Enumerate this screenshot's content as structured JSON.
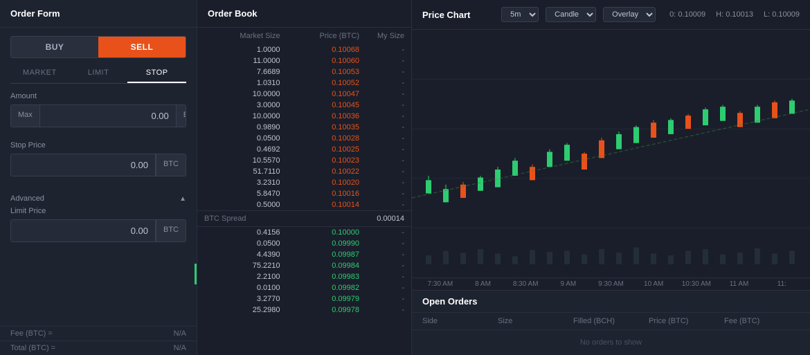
{
  "orderForm": {
    "title": "Order Form",
    "buyLabel": "BUY",
    "sellLabel": "SELL",
    "orderTypes": [
      "MARKET",
      "LIMIT",
      "STOP"
    ],
    "activeOrderType": "STOP",
    "amountLabel": "Amount",
    "amountPrefix": "Max",
    "amountValue": "0.00",
    "amountCurrency": "BCH",
    "stopPriceLabel": "Stop Price",
    "stopPriceValue": "0.00",
    "stopPriceCurrency": "BTC",
    "advancedLabel": "Advanced",
    "limitPriceLabel": "Limit Price",
    "limitPriceValue": "0.00",
    "limitPriceCurrency": "BTC",
    "feeLabelLeft": "Fee (BTC) =",
    "feeValueRight": "N/A",
    "totalLabelLeft": "Total (BTC) =",
    "totalValueRight": "N/A"
  },
  "orderBook": {
    "title": "Order Book",
    "headers": {
      "marketSize": "Market Size",
      "price": "Price (BTC)",
      "mySize": "My Size"
    },
    "asks": [
      {
        "size": "1.0000",
        "price": "0.10068",
        "mySize": "-"
      },
      {
        "size": "11.0000",
        "price": "0.10060",
        "mySize": "-"
      },
      {
        "size": "7.6689",
        "price": "0.10053",
        "mySize": "-"
      },
      {
        "size": "1.0310",
        "price": "0.10052",
        "mySize": "-"
      },
      {
        "size": "10.0000",
        "price": "0.10047",
        "mySize": "-"
      },
      {
        "size": "3.0000",
        "price": "0.10045",
        "mySize": "-"
      },
      {
        "size": "10.0000",
        "price": "0.10036",
        "mySize": "-"
      },
      {
        "size": "0.9890",
        "price": "0.10035",
        "mySize": "-"
      },
      {
        "size": "0.0500",
        "price": "0.10028",
        "mySize": "-"
      },
      {
        "size": "0.4692",
        "price": "0.10025",
        "mySize": "-"
      },
      {
        "size": "10.5570",
        "price": "0.10023",
        "mySize": "-"
      },
      {
        "size": "51.7110",
        "price": "0.10022",
        "mySize": "-"
      },
      {
        "size": "3.2310",
        "price": "0.10020",
        "mySize": "-"
      },
      {
        "size": "5.8470",
        "price": "0.10016",
        "mySize": "-"
      },
      {
        "size": "0.5000",
        "price": "0.10014",
        "mySize": "-"
      }
    ],
    "spread": {
      "label": "BTC Spread",
      "value": "0.00014"
    },
    "bids": [
      {
        "size": "0.4156",
        "price": "0.10000",
        "mySize": "-"
      },
      {
        "size": "0.0500",
        "price": "0.09990",
        "mySize": "-"
      },
      {
        "size": "4.4390",
        "price": "0.09987",
        "mySize": "-"
      },
      {
        "size": "75.2210",
        "price": "0.09984",
        "mySize": "-"
      },
      {
        "size": "2.2100",
        "price": "0.09983",
        "mySize": "-"
      },
      {
        "size": "0.0100",
        "price": "0.09982",
        "mySize": "-"
      },
      {
        "size": "3.2770",
        "price": "0.09979",
        "mySize": "-"
      },
      {
        "size": "25.2980",
        "price": "0.09978",
        "mySize": "-"
      }
    ]
  },
  "priceChart": {
    "title": "Price Chart",
    "timeframe": "5m",
    "chartType": "Candle",
    "overlay": "Overlay",
    "ohlc": {
      "open": "0: 0.10009",
      "high": "H: 0.10013",
      "low": "L: 0.10009"
    },
    "timeLabels": [
      "7:30 AM",
      "8 AM",
      "8:30 AM",
      "9 AM",
      "9:30 AM",
      "10 AM",
      "10:30 AM",
      "11 AM",
      "11:"
    ]
  },
  "openOrders": {
    "title": "Open Orders",
    "columns": [
      "Side",
      "Size",
      "Filled (BCH)",
      "Price (BTC)",
      "Fee (BTC)"
    ],
    "emptyMessage": "No orders to show"
  }
}
